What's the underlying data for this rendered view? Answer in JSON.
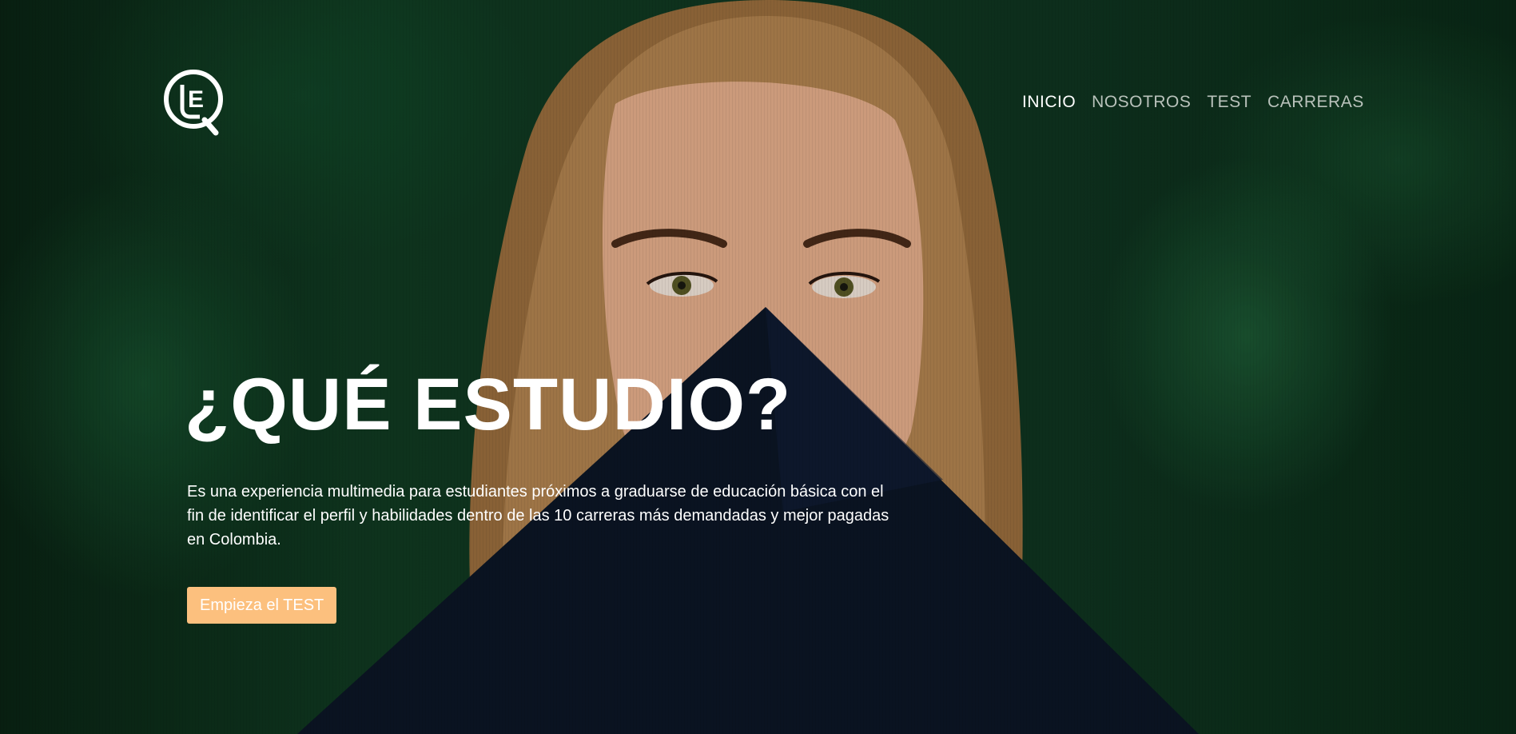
{
  "brand": {
    "logo_icon": "question-mark-circle-logo",
    "logo_text": "E"
  },
  "nav": {
    "items": [
      {
        "label": "INICIO",
        "active": true
      },
      {
        "label": "NOSOTROS",
        "active": false
      },
      {
        "label": "TEST",
        "active": false
      },
      {
        "label": "CARRERAS",
        "active": false
      }
    ]
  },
  "hero": {
    "title": "¿QUÉ ESTUDIO?",
    "description": "Es una experiencia multimedia para estudiantes próximos a graduarse de educación básica con el fin de identificar el perfil y habilidades dentro de las 10 carreras más demandadas y mejor pagadas en Colombia.",
    "cta_label": "Empieza el TEST"
  },
  "colors": {
    "cta_background": "#fcc07e",
    "nav_active": "#ffffff",
    "nav_inactive": "#b9c2bb",
    "background_foliage": "#103b22",
    "mortarboard": "#0c1626"
  }
}
